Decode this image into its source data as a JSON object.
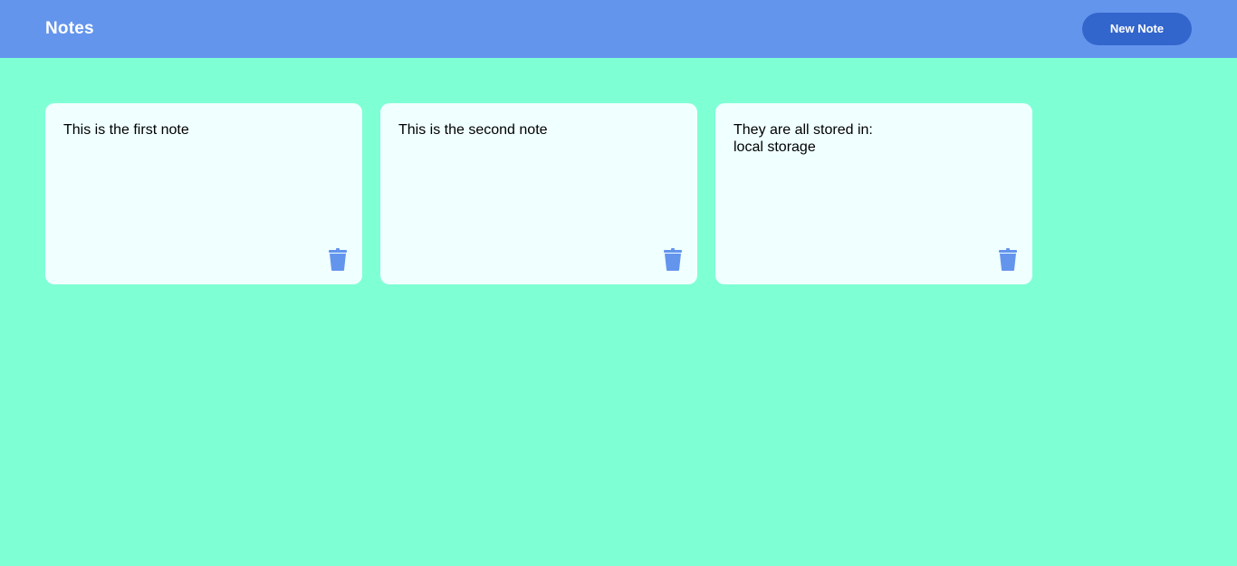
{
  "header": {
    "title": "Notes",
    "new_note_label": "New Note"
  },
  "colors": {
    "background": "#7fffd4",
    "header": "#6495ed",
    "button": "#3366cc",
    "card": "#f0ffff",
    "icon": "#6495ed"
  },
  "notes": [
    {
      "text": "This is the first note",
      "icon": "trash-icon"
    },
    {
      "text": "This is the second note",
      "icon": "trash-icon"
    },
    {
      "text": "They are all stored in:\nlocal storage",
      "icon": "trash-icon"
    }
  ]
}
